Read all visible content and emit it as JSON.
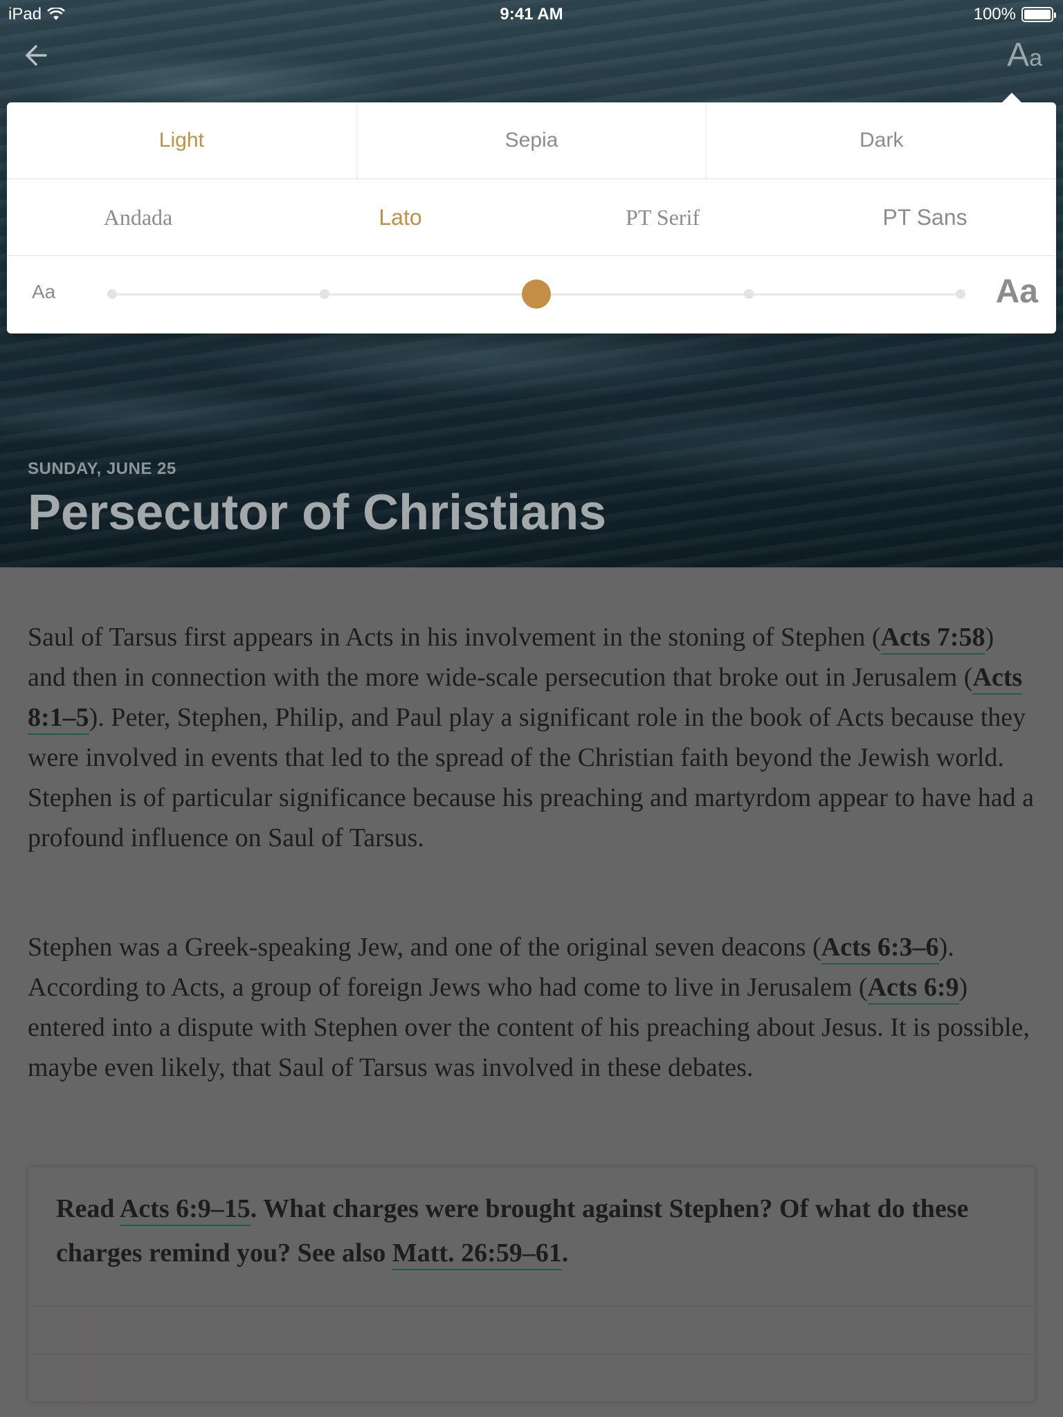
{
  "status_bar": {
    "device": "iPad",
    "time": "9:41 AM",
    "battery": "100%"
  },
  "nav": {
    "back_icon": "arrow-left-icon",
    "text_settings_big": "A",
    "text_settings_small": "a"
  },
  "settings": {
    "themes": [
      {
        "label": "Light",
        "active": true
      },
      {
        "label": "Sepia",
        "active": false
      },
      {
        "label": "Dark",
        "active": false
      }
    ],
    "fonts": [
      {
        "label": "Andada",
        "active": false
      },
      {
        "label": "Lato",
        "active": true
      },
      {
        "label": "PT Serif",
        "active": false
      },
      {
        "label": "PT Sans",
        "active": false
      }
    ],
    "size_small_label": "Aa",
    "size_large_label": "Aa",
    "size_steps": 5,
    "size_selected_index": 2,
    "accent_color": "#c48f45"
  },
  "hero": {
    "date": "SUNDAY, JUNE 25",
    "title": "Persecutor of Christians"
  },
  "content": {
    "p1": [
      {
        "t": "Saul of Tarsus first appears in Acts in his involvement in the stoning of Stephen ("
      },
      {
        "t": "Acts 7:58",
        "ref": true
      },
      {
        "t": ") and then in connection with the more wide-scale persecution that broke out in Jerusalem ("
      },
      {
        "t": "Acts 8:1–5",
        "ref": true
      },
      {
        "t": "). Peter, Stephen, Philip, and Paul play a significant role in the book of Acts because they were involved in events that led to the spread of the Christian faith beyond the Jewish world. Stephen is of particular significance because his preaching and martyrdom appear to have had a profound influence on Saul of Tarsus."
      }
    ],
    "p2": [
      {
        "t": "Stephen was a Greek-speaking Jew, and one of the original seven deacons ("
      },
      {
        "t": "Acts 6:3–6",
        "ref": true
      },
      {
        "t": "). According to Acts, a group of foreign Jews who had come to live in Jerusalem ("
      },
      {
        "t": "Acts 6:9",
        "ref": true
      },
      {
        "t": ") entered into a dispute with Stephen over the content of his preaching about Jesus. It is possible, maybe even likely, that Saul of Tarsus was involved in these debates."
      }
    ],
    "question": [
      {
        "t": "Read "
      },
      {
        "t": "Acts 6:9–15",
        "ref": true
      },
      {
        "t": ". What charges were brought against Stephen? Of what do these charges remind you? See also "
      },
      {
        "t": "Matt. 26:59–61",
        "ref": true
      },
      {
        "t": "."
      }
    ]
  }
}
